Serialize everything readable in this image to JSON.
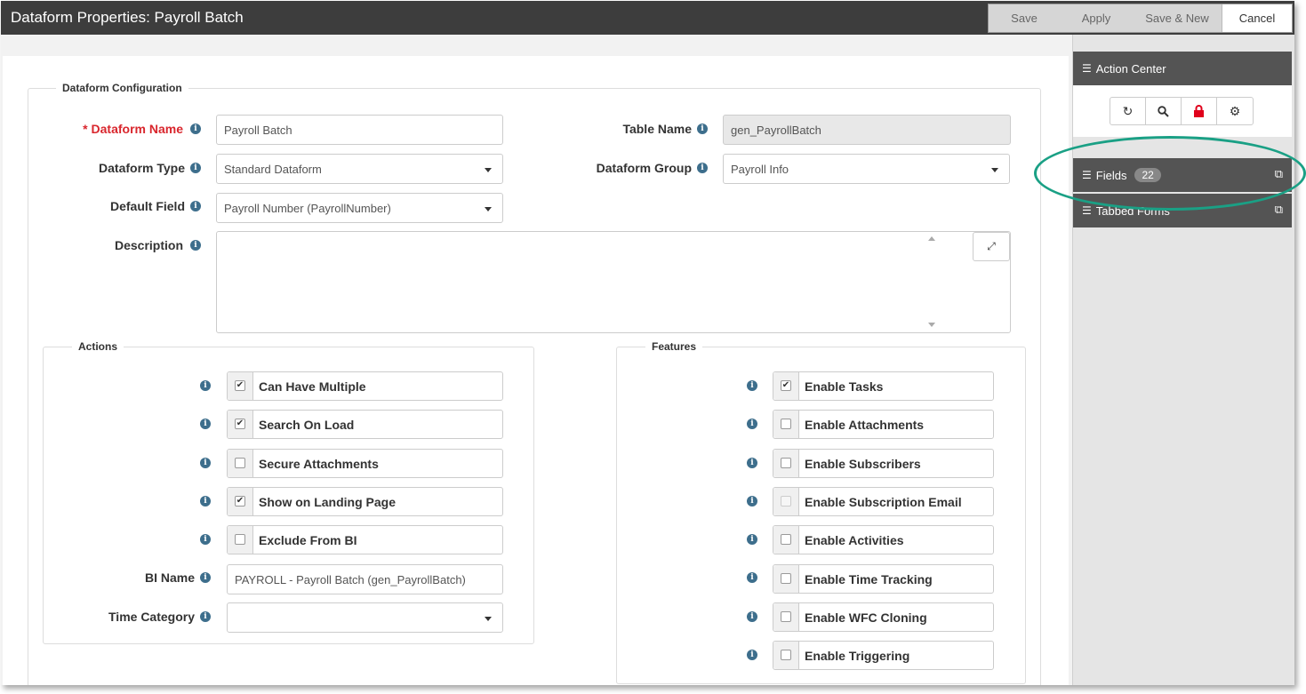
{
  "window": {
    "title": "Dataform Properties: Payroll Batch",
    "buttons": {
      "save": "Save",
      "apply": "Apply",
      "save_new": "Save & New",
      "cancel": "Cancel"
    }
  },
  "config": {
    "legend": "Dataform Configuration",
    "dataform_name": {
      "label": "* Dataform Name",
      "value": "Payroll Batch"
    },
    "table_name": {
      "label": "Table Name",
      "value": "gen_PayrollBatch"
    },
    "dataform_type": {
      "label": "Dataform Type",
      "value": "Standard Dataform"
    },
    "dataform_group": {
      "label": "Dataform Group",
      "value": "Payroll Info"
    },
    "default_field": {
      "label": "Default Field",
      "value": "Payroll Number (PayrollNumber)"
    },
    "description": {
      "label": "Description",
      "value": ""
    }
  },
  "actions": {
    "legend": "Actions",
    "items": [
      {
        "label": "Can Have Multiple",
        "checked": true
      },
      {
        "label": "Search On Load",
        "checked": true
      },
      {
        "label": "Secure Attachments",
        "checked": false
      },
      {
        "label": "Show on Landing Page",
        "checked": true
      },
      {
        "label": "Exclude From BI",
        "checked": false
      }
    ],
    "bi_name": {
      "label": "BI Name",
      "value": "PAYROLL - Payroll Batch (gen_PayrollBatch)"
    },
    "time_category": {
      "label": "Time Category",
      "value": ""
    }
  },
  "features": {
    "legend": "Features",
    "items": [
      {
        "label": "Enable Tasks",
        "checked": true
      },
      {
        "label": "Enable Attachments",
        "checked": false
      },
      {
        "label": "Enable Subscribers",
        "checked": false
      },
      {
        "label": "Enable Subscription Email",
        "checked": false,
        "disabled": true
      },
      {
        "label": "Enable Activities",
        "checked": false
      },
      {
        "label": "Enable Time Tracking",
        "checked": false
      },
      {
        "label": "Enable WFC Cloning",
        "checked": false
      },
      {
        "label": "Enable Triggering",
        "checked": false
      }
    ]
  },
  "sidebar": {
    "action_center": "Action Center",
    "icons": [
      "refresh-icon",
      "search-icon",
      "lock-icon",
      "gear-icon"
    ],
    "fields": {
      "label": "Fields",
      "count": "22"
    },
    "tabbed_forms": {
      "label": "Tabbed Forms"
    }
  },
  "colors": {
    "titlebar": "#3d3d3d",
    "required": "#d9262d",
    "info_icon": "#3d6e8c",
    "lock_icon": "#e0001b",
    "highlight": "#1aa085"
  }
}
